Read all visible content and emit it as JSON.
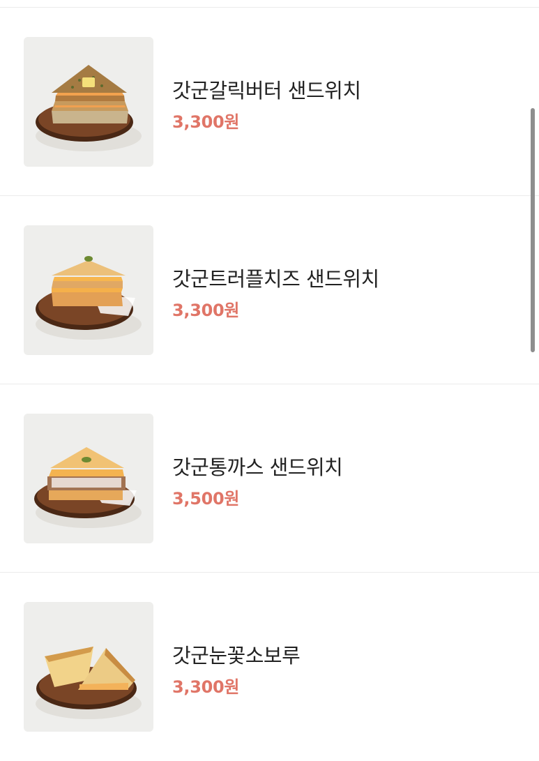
{
  "menu": {
    "items": [
      {
        "name": "갓군갈릭버터 샌드위치",
        "price": "3,300원"
      },
      {
        "name": "갓군트러플치즈 샌드위치",
        "price": "3,300원"
      },
      {
        "name": "갓군통까스 샌드위치",
        "price": "3,500원"
      },
      {
        "name": "갓군눈꽃소보루",
        "price": "3,300원"
      }
    ]
  },
  "colors": {
    "price": "#e07567",
    "name": "#222222",
    "divider": "#ebebeb",
    "thumb_bg": "#eeeeec"
  }
}
